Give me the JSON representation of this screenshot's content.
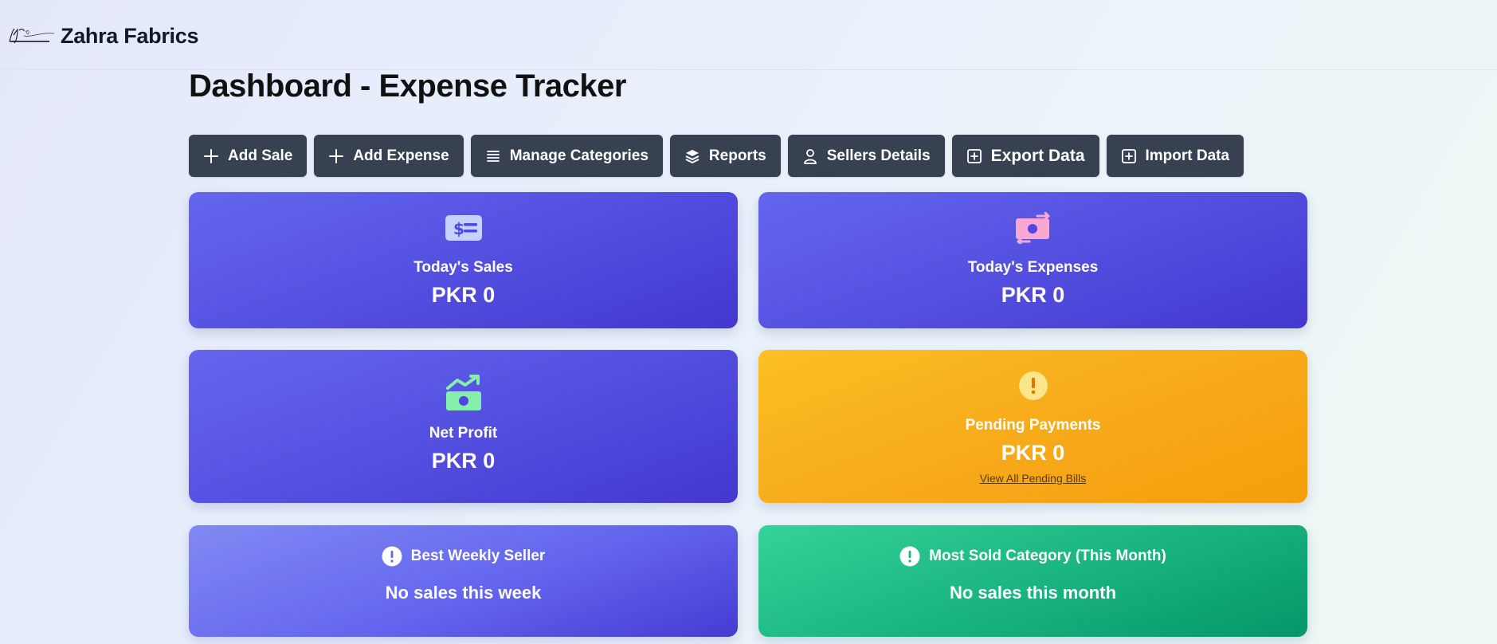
{
  "header": {
    "brand": "Zahra Fabrics",
    "logo_alt": "ZAHRA FABRICS"
  },
  "page": {
    "title": "Dashboard - Expense Tracker"
  },
  "toolbar": {
    "buttons": [
      {
        "label": "Add Sale",
        "icon": "plus-icon"
      },
      {
        "label": "Add Expense",
        "icon": "plus-icon"
      },
      {
        "label": "Manage Categories",
        "icon": "list-icon"
      },
      {
        "label": "Reports",
        "icon": "layers-icon"
      },
      {
        "label": "Sellers Details",
        "icon": "user-icon"
      },
      {
        "label": "Export Data",
        "icon": "plus-square-icon"
      },
      {
        "label": "Import Data",
        "icon": "plus-square-icon"
      }
    ]
  },
  "cards": {
    "todays_sales": {
      "label": "Today's Sales",
      "value": "PKR 0",
      "icon": "money-bill-icon"
    },
    "todays_expenses": {
      "label": "Today's Expenses",
      "value": "PKR 0",
      "icon": "money-transfer-icon"
    },
    "net_profit": {
      "label": "Net Profit",
      "value": "PKR 0",
      "icon": "money-trend-icon"
    },
    "pending_payments": {
      "label": "Pending Payments",
      "value": "PKR 0",
      "link": "View All Pending Bills",
      "icon": "exclamation-circle-icon"
    },
    "best_weekly_seller": {
      "label": "Best Weekly Seller",
      "value": "No sales this week",
      "icon": "exclamation-circle-icon"
    },
    "most_sold_category": {
      "label": "Most Sold Category (This Month)",
      "value": "No sales this month",
      "icon": "exclamation-circle-icon"
    }
  },
  "colors": {
    "button_bg": "#374151",
    "indigo_card": "#5450e0",
    "amber_card": "#f59e0b",
    "green_card": "#10b981"
  }
}
